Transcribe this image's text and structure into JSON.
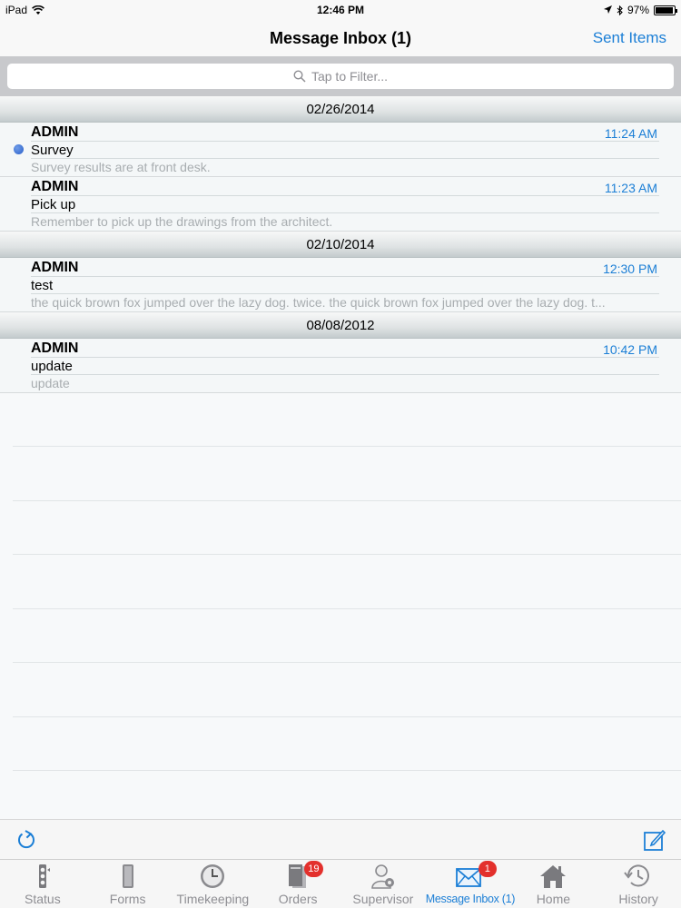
{
  "status_bar": {
    "carrier": "iPad",
    "time": "12:46 PM",
    "battery": "97%",
    "battery_level": 0.97
  },
  "navbar": {
    "title": "Message Inbox (1)",
    "right_button": "Sent Items"
  },
  "search": {
    "placeholder": "Tap to Filter..."
  },
  "sections": [
    {
      "date": "02/26/2014",
      "messages": [
        {
          "sender": "ADMIN",
          "time": "11:24 AM",
          "subject": "Survey",
          "preview": "Survey results are at front desk.",
          "unread": true
        },
        {
          "sender": "ADMIN",
          "time": "11:23 AM",
          "subject": "Pick up",
          "preview": "Remember to pick up the drawings from the architect.",
          "unread": false
        }
      ]
    },
    {
      "date": "02/10/2014",
      "messages": [
        {
          "sender": "ADMIN",
          "time": "12:30 PM",
          "subject": "test",
          "preview": "the quick brown fox jumped over the lazy dog. twice. the quick brown fox jumped over the lazy dog. t...",
          "unread": false
        }
      ]
    },
    {
      "date": "08/08/2012",
      "messages": [
        {
          "sender": "ADMIN",
          "time": "10:42 PM",
          "subject": "update",
          "preview": "update",
          "unread": false
        }
      ]
    }
  ],
  "toolbar": {
    "refresh_icon": "refresh-icon",
    "compose_icon": "compose-icon"
  },
  "tabs": [
    {
      "label": "Status",
      "icon": "status-icon"
    },
    {
      "label": "Forms",
      "icon": "forms-icon"
    },
    {
      "label": "Timekeeping",
      "icon": "clock-icon"
    },
    {
      "label": "Orders",
      "icon": "orders-icon",
      "badge": "19"
    },
    {
      "label": "Supervisor",
      "icon": "supervisor-icon"
    },
    {
      "label": "Message Inbox (1)",
      "icon": "envelope-icon",
      "badge": "1",
      "active": true
    },
    {
      "label": "Home",
      "icon": "home-icon"
    },
    {
      "label": "History",
      "icon": "history-icon"
    }
  ],
  "colors": {
    "accent": "#1c7fd6",
    "badge": "#e3302c",
    "unread_dot": "#2a5fc9"
  }
}
